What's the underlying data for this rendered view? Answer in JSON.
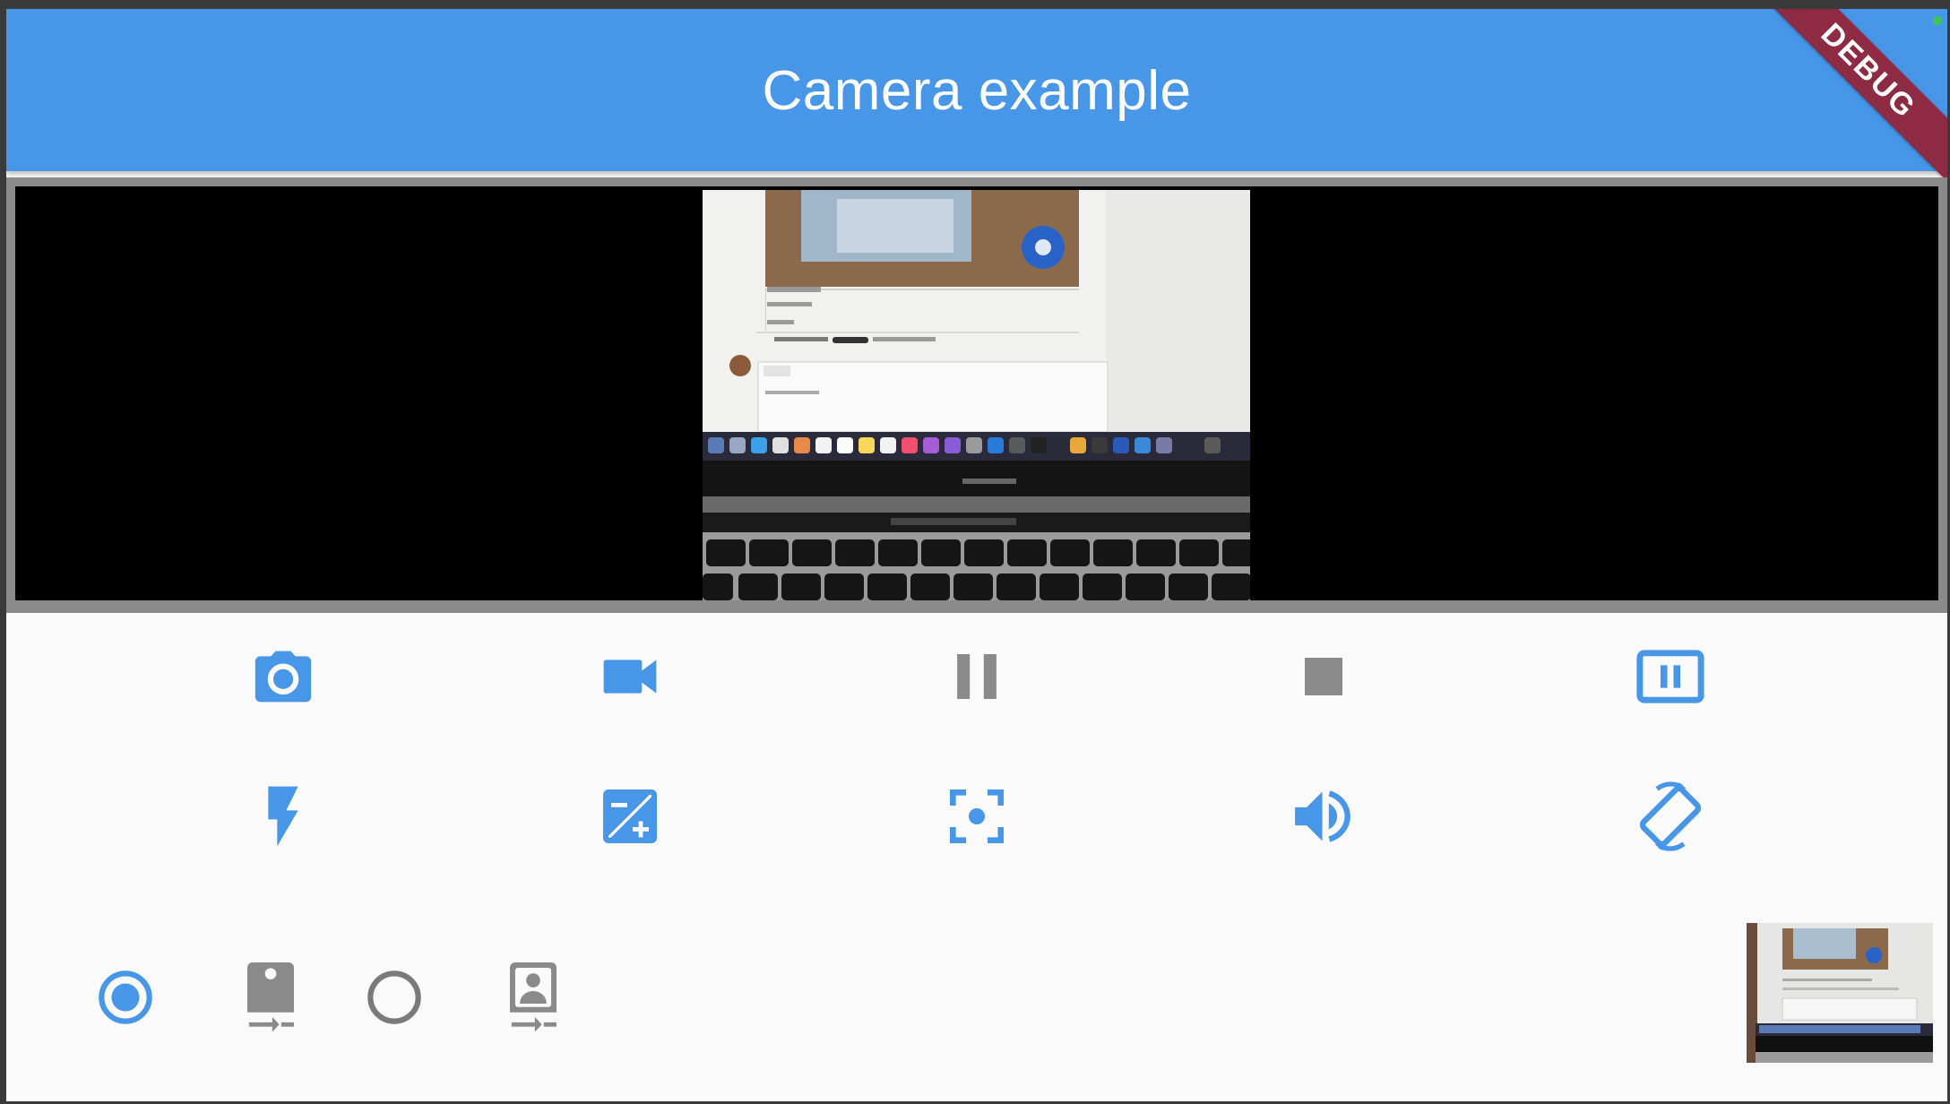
{
  "app": {
    "title": "Camera example",
    "debug_banner": "DEBUG",
    "accent_color": "#4796e8",
    "disabled_color": "#8a8a8a"
  },
  "camera_preview": {
    "feed": "live-camera-preview"
  },
  "control_rows": [
    [
      {
        "name": "take-picture-button",
        "icon": "camera-icon",
        "enabled": true
      },
      {
        "name": "record-video-button",
        "icon": "videocam-icon",
        "enabled": true
      },
      {
        "name": "pause-recording-button",
        "icon": "pause-icon",
        "enabled": false
      },
      {
        "name": "stop-recording-button",
        "icon": "stop-icon",
        "enabled": false
      },
      {
        "name": "pause-preview-button",
        "icon": "pause-presentation-icon",
        "enabled": true
      }
    ],
    [
      {
        "name": "flash-mode-button",
        "icon": "flash-on-icon",
        "enabled": true
      },
      {
        "name": "exposure-mode-button",
        "icon": "exposure-icon",
        "enabled": true
      },
      {
        "name": "focus-mode-button",
        "icon": "filter-center-focus-icon",
        "enabled": true
      },
      {
        "name": "audio-toggle-button",
        "icon": "volume-up-icon",
        "enabled": true
      },
      {
        "name": "capture-orientation-lock-button",
        "icon": "screen-rotation-icon",
        "enabled": true
      }
    ]
  ],
  "camera_selection": [
    {
      "name": "camera-option-back",
      "icon": "camera-rear-icon",
      "selected": true
    },
    {
      "name": "camera-option-front",
      "icon": "camera-front-icon",
      "selected": false
    }
  ],
  "thumbnail": {
    "name": "last-capture-thumbnail"
  }
}
